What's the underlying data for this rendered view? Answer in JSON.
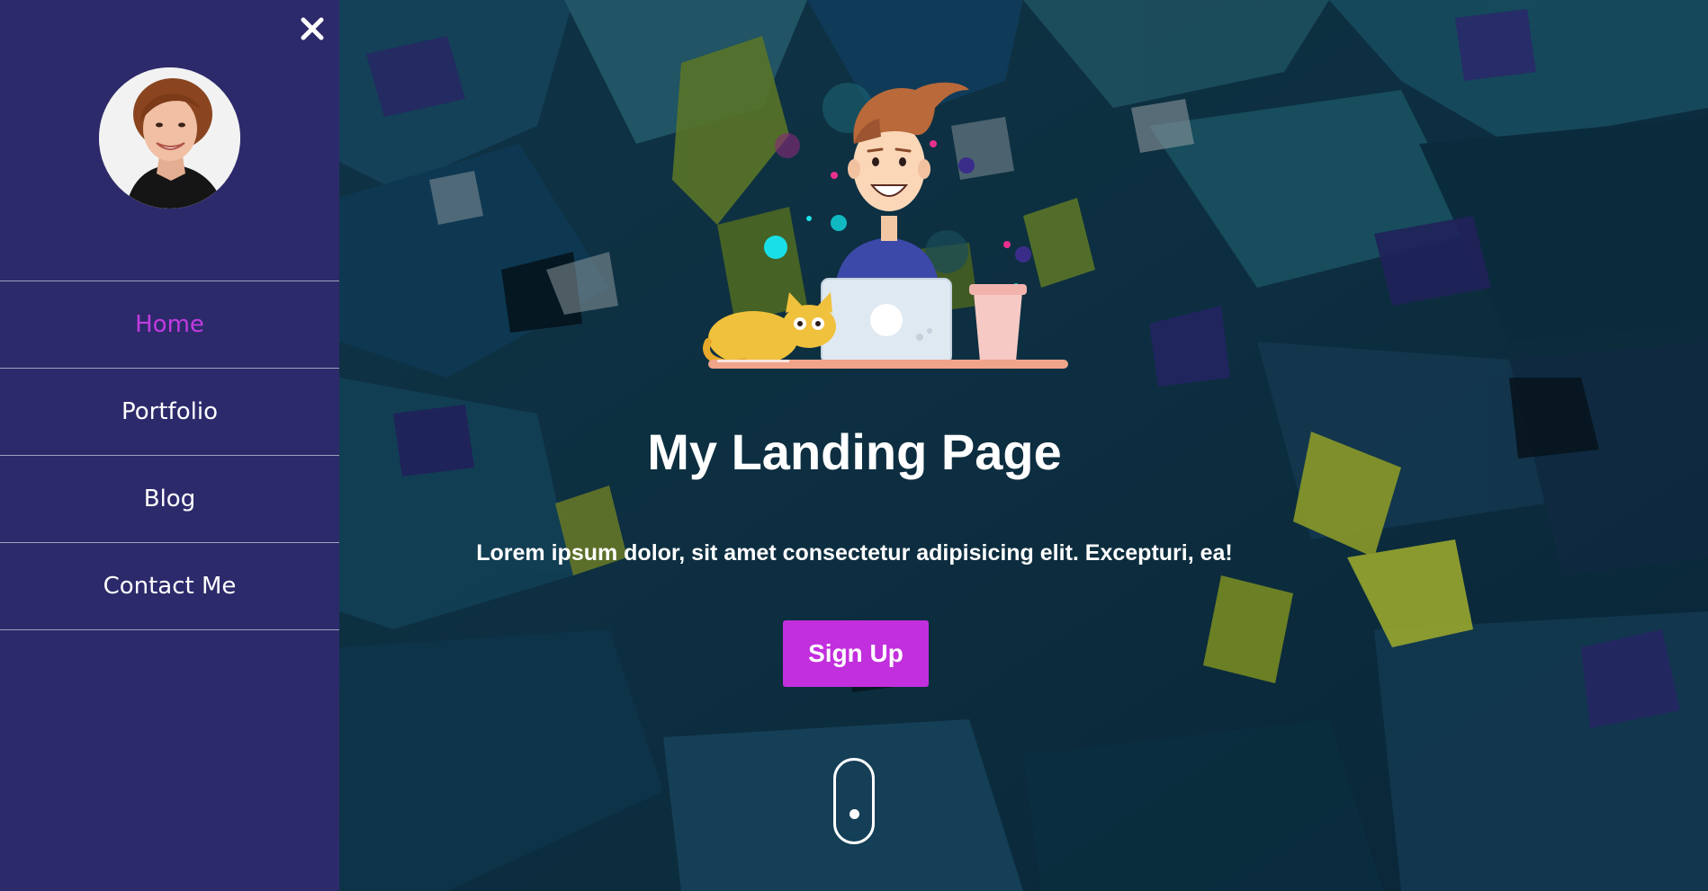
{
  "sidebar": {
    "close_icon": "close-icon",
    "avatar_alt": "profile photo",
    "nav": [
      {
        "label": "Home",
        "active": true
      },
      {
        "label": "Portfolio",
        "active": false
      },
      {
        "label": "Blog",
        "active": false
      },
      {
        "label": "Contact Me",
        "active": false
      }
    ]
  },
  "hero": {
    "title": "My Landing Page",
    "text": "Lorem ipsum dolor, sit amet consectetur adipisicing elit. Excepturi, ea!",
    "signup_label": "Sign Up",
    "scroll_icon": "mouse-scroll-icon"
  },
  "colors": {
    "sidebar_bg": "#2d2a6b",
    "accent": "#c22fdd",
    "active_nav": "#c23be0",
    "text": "#ffffff"
  }
}
